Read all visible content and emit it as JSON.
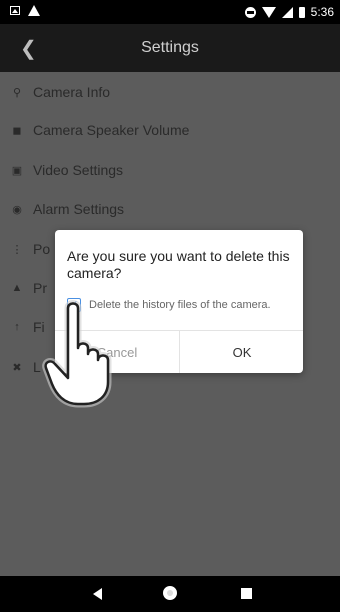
{
  "status_bar": {
    "time": "5:36"
  },
  "app_bar": {
    "title": "Settings",
    "back_icon": "chevron-left-icon"
  },
  "menu": [
    {
      "label": "Camera Info",
      "icon": "camera-icon"
    },
    {
      "label": "Camera Speaker Volume",
      "icon": "speaker-icon"
    },
    {
      "label": "Video Settings",
      "icon": "video-icon"
    },
    {
      "label": "Alarm Settings",
      "icon": "alarm-icon"
    },
    {
      "label": "Po",
      "icon": "power-icon"
    },
    {
      "label": "Pr",
      "icon": "warning-icon"
    },
    {
      "label": "Fi",
      "icon": "upload-icon"
    },
    {
      "label": "L",
      "icon": "close-circle-icon"
    }
  ],
  "dialog": {
    "message": "Are you sure you want to delete this camera?",
    "checkbox_label": "Delete the history files of the camera.",
    "checkbox_checked": true,
    "cancel_label": "Cancel",
    "ok_label": "OK"
  },
  "colors": {
    "accent": "#2a7de1",
    "app_bar": "#1a1a1a",
    "dim_background": "#5c5c5c"
  }
}
